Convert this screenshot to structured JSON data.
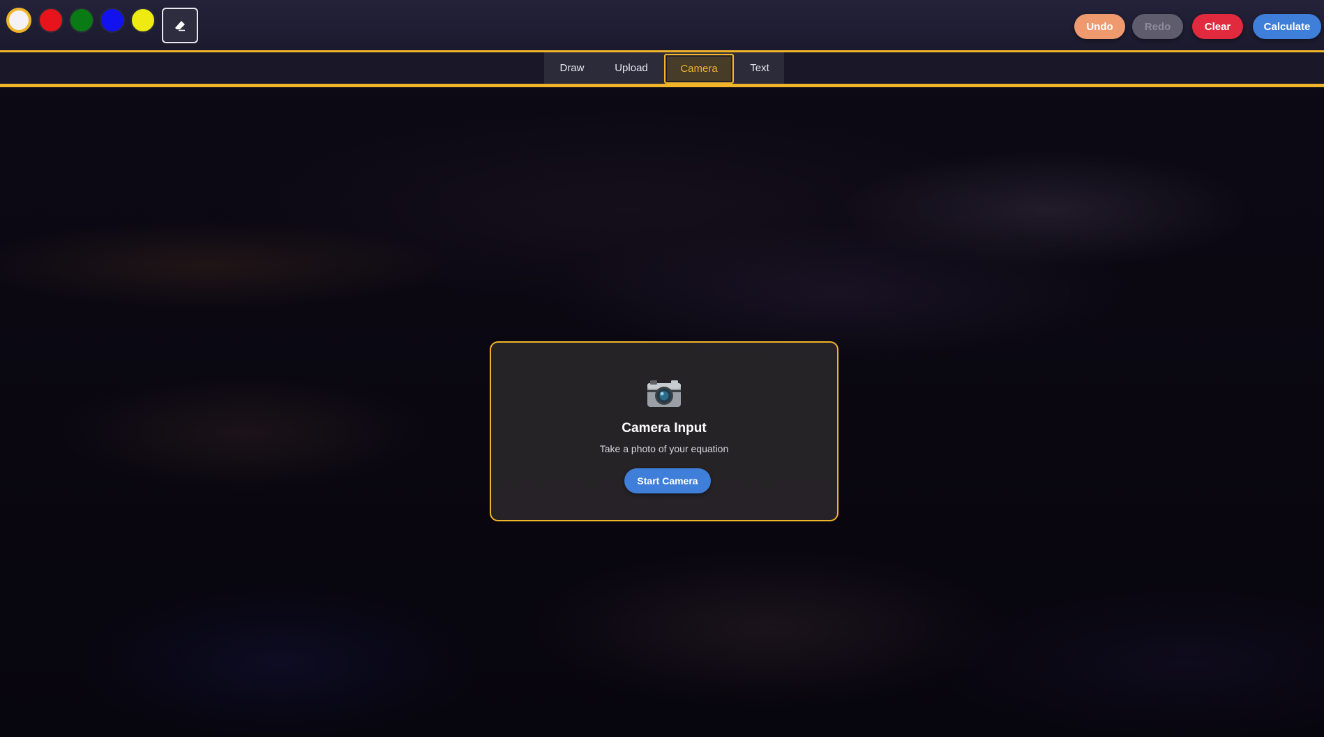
{
  "palette": {
    "colors": [
      "#f4f2f7",
      "#e8141c",
      "#0a7a14",
      "#1212ee",
      "#eeea12"
    ],
    "selected_index": 0,
    "selection_ring_color": "#f0b52a"
  },
  "tools": {
    "eraser_icon": "eraser-icon"
  },
  "actions": {
    "undo_label": "Undo",
    "redo_label": "Redo",
    "clear_label": "Clear",
    "calculate_label": "Calculate",
    "undo_color": "#ef9a6e",
    "redo_color": "#5e5c6d",
    "clear_color": "#e12a3d",
    "calculate_color": "#3f7fd9"
  },
  "tabs": [
    {
      "label": "Draw",
      "active": false
    },
    {
      "label": "Upload",
      "active": false
    },
    {
      "label": "Camera",
      "active": true
    },
    {
      "label": "Text",
      "active": false
    }
  ],
  "camera_card": {
    "icon": "camera-icon",
    "title": "Camera Input",
    "subtitle": "Take a photo of your equation",
    "start_label": "Start Camera"
  },
  "theme": {
    "accent": "#f0b52a"
  }
}
